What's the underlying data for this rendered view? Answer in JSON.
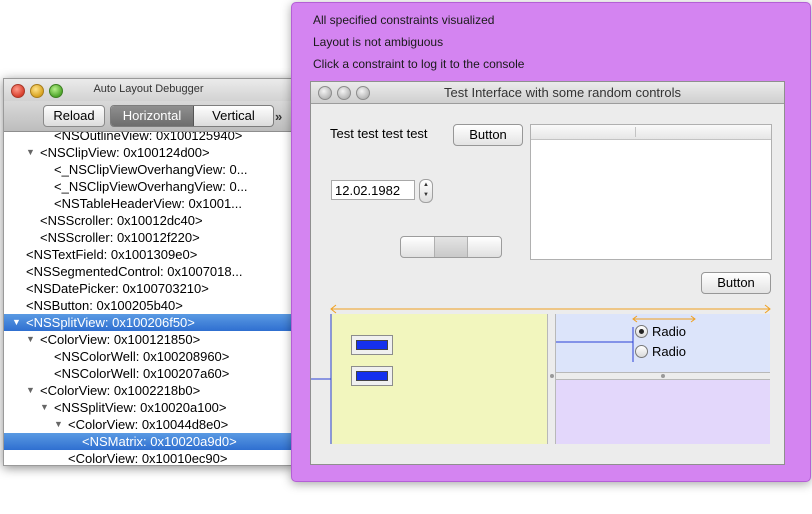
{
  "debugger": {
    "title": "Auto Layout Debugger",
    "toolbar": {
      "reload_label": "Reload",
      "orientation_segments": [
        "Horizontal",
        "Vertical"
      ],
      "selected_segment": "Horizontal",
      "overflow_label": "»"
    },
    "tree": [
      {
        "label": "<NSOutlineView: 0x100125940>",
        "level": 3,
        "expanded": null,
        "selected": false
      },
      {
        "label": "<NSClipView: 0x100124d00>",
        "level": 2,
        "expanded": true,
        "selected": false
      },
      {
        "label": "<_NSClipViewOverhangView: 0...",
        "level": 3,
        "expanded": null,
        "selected": false
      },
      {
        "label": "<_NSClipViewOverhangView: 0...",
        "level": 3,
        "expanded": null,
        "selected": false
      },
      {
        "label": "<NSTableHeaderView: 0x1001...",
        "level": 3,
        "expanded": null,
        "selected": false
      },
      {
        "label": "<NSScroller: 0x10012dc40>",
        "level": 2,
        "expanded": null,
        "selected": false
      },
      {
        "label": "<NSScroller: 0x10012f220>",
        "level": 2,
        "expanded": null,
        "selected": false
      },
      {
        "label": "<NSTextField: 0x1001309e0>",
        "level": 1,
        "expanded": null,
        "selected": false
      },
      {
        "label": "<NSSegmentedControl: 0x1007018...",
        "level": 1,
        "expanded": null,
        "selected": false
      },
      {
        "label": "<NSDatePicker: 0x100703210>",
        "level": 1,
        "expanded": null,
        "selected": false
      },
      {
        "label": "<NSButton: 0x100205b40>",
        "level": 1,
        "expanded": null,
        "selected": false
      },
      {
        "label": "<NSSplitView: 0x100206f50>",
        "level": 1,
        "expanded": true,
        "selected": true
      },
      {
        "label": "<ColorView: 0x100121850>",
        "level": 2,
        "expanded": true,
        "selected": false
      },
      {
        "label": "<NSColorWell: 0x100208960>",
        "level": 3,
        "expanded": null,
        "selected": false
      },
      {
        "label": "<NSColorWell: 0x100207a60>",
        "level": 3,
        "expanded": null,
        "selected": false
      },
      {
        "label": "<ColorView: 0x1002218b0>",
        "level": 2,
        "expanded": true,
        "selected": false
      },
      {
        "label": "<NSSplitView: 0x10020a100>",
        "level": 3,
        "expanded": true,
        "selected": false
      },
      {
        "label": "<ColorView: 0x10044d8e0>",
        "level": 4,
        "expanded": true,
        "selected": false
      },
      {
        "label": "<NSMatrix: 0x10020a9d0>",
        "level": 5,
        "expanded": null,
        "selected": true
      },
      {
        "label": "<ColorView: 0x10010ec90>",
        "level": 4,
        "expanded": null,
        "selected": false
      }
    ]
  },
  "overlay": {
    "messages": [
      "All specified constraints visualized",
      "Layout is not ambiguous",
      "Click a constraint to log it to the console"
    ],
    "accent_color": "#d484f1"
  },
  "test_window": {
    "title": "Test Interface with some random controls",
    "label_text": "Test test test test",
    "button_top_label": "Button",
    "button_right_label": "Button",
    "date_value": "12.02.1982",
    "radio_options": [
      "Radio",
      "Radio"
    ],
    "radio_selected": 0,
    "colors": {
      "yellow_pane": "#f2f6be",
      "blue_pane": "#dce4fa",
      "lavender_pane": "#e3d7fb",
      "color_well": "#1530ee",
      "constraint_orange": "#f0a020",
      "constraint_blue": "#2a3fd6"
    }
  }
}
